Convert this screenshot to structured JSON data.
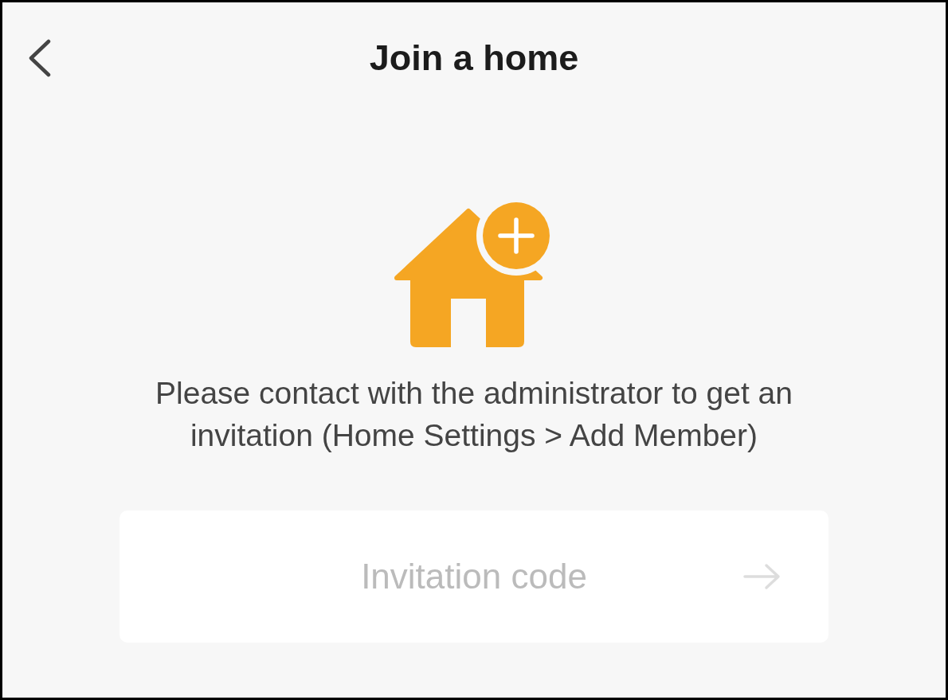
{
  "header": {
    "title": "Join a home"
  },
  "message": "Please contact with the administrator to get an invitation (Home Settings > Add Member)",
  "invitation": {
    "placeholder": "Invitation code",
    "submit_disabled": true
  }
}
